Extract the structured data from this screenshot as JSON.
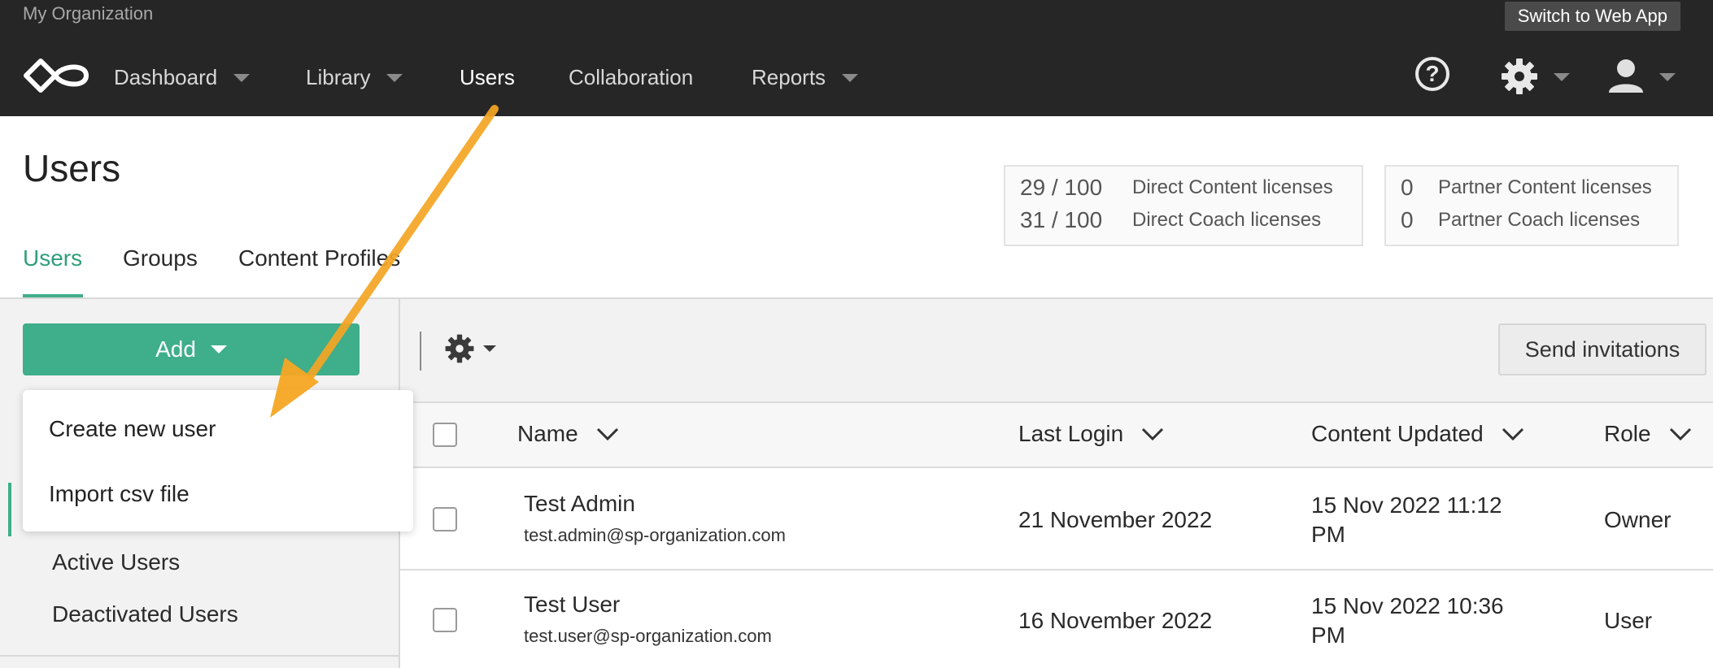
{
  "org": {
    "name": "My Organization"
  },
  "switch_button": "Switch to Web App",
  "nav": {
    "items": [
      {
        "label": "Dashboard",
        "has_caret": true
      },
      {
        "label": "Library",
        "has_caret": true
      },
      {
        "label": "Users",
        "has_caret": false,
        "active": true
      },
      {
        "label": "Collaboration",
        "has_caret": false
      },
      {
        "label": "Reports",
        "has_caret": true
      }
    ],
    "icons": [
      "help-icon",
      "gear-icon",
      "user-icon"
    ]
  },
  "page": {
    "title": "Users"
  },
  "tabs": [
    {
      "label": "Users",
      "active": true
    },
    {
      "label": "Groups"
    },
    {
      "label": "Content Profiles"
    }
  ],
  "licenses": {
    "direct": [
      {
        "value": "29 / 100",
        "label": "Direct Content licenses"
      },
      {
        "value": "31 / 100",
        "label": "Direct Coach licenses"
      }
    ],
    "partner": [
      {
        "value": "0",
        "label": "Partner Content licenses"
      },
      {
        "value": "0",
        "label": "Partner Coach licenses"
      }
    ]
  },
  "toolbar": {
    "add_label": "Add",
    "send_invitations": "Send invitations"
  },
  "add_menu": {
    "items": [
      "Create new user",
      "Import csv file"
    ]
  },
  "sidebar": {
    "items": [
      "Active Users",
      "Deactivated Users"
    ]
  },
  "table": {
    "columns": [
      "Name",
      "Last Login",
      "Content Updated",
      "Role"
    ],
    "rows": [
      {
        "name": "Test Admin",
        "email": "test.admin@sp-organization.com",
        "last_login": "21 November 2022",
        "updated_line1": "15 Nov 2022 11:12",
        "updated_line2": "PM",
        "role": "Owner"
      },
      {
        "name": "Test User",
        "email": "test.user@sp-organization.com",
        "last_login": "16 November 2022",
        "updated_line1": "15 Nov 2022 10:36",
        "updated_line2": "PM",
        "role": "User"
      }
    ]
  },
  "colors": {
    "accent": "#3fae8a",
    "topbar": "#262626",
    "annotation_arrow": "#f5a623"
  }
}
